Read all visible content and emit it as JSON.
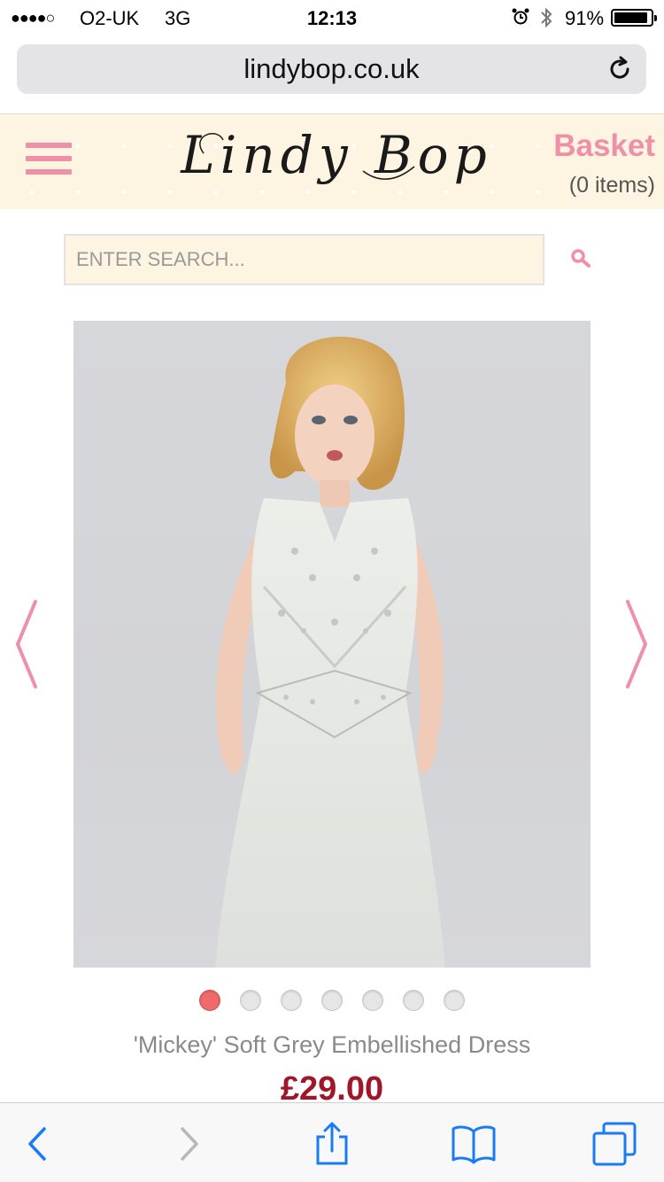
{
  "status_bar": {
    "signal": "●●●●○",
    "carrier": "O2-UK",
    "network": "3G",
    "time": "12:13",
    "battery": "91%"
  },
  "browser": {
    "url": "lindybop.co.uk"
  },
  "header": {
    "logo_text": "Lindy Bop",
    "basket_label": "Basket",
    "basket_count": "(0 items)"
  },
  "search": {
    "placeholder": "ENTER SEARCH..."
  },
  "product": {
    "title": "'Mickey' Soft Grey Embellished Dress",
    "price": "£29.00",
    "image_count": 7,
    "active_image": 1
  },
  "colors": {
    "brand_pink": "#ef8fa8",
    "header_bg": "#fdf4e1",
    "price_red": "#a0172a",
    "active_dot": "#f06a6a",
    "ios_blue": "#1a7cf5"
  }
}
